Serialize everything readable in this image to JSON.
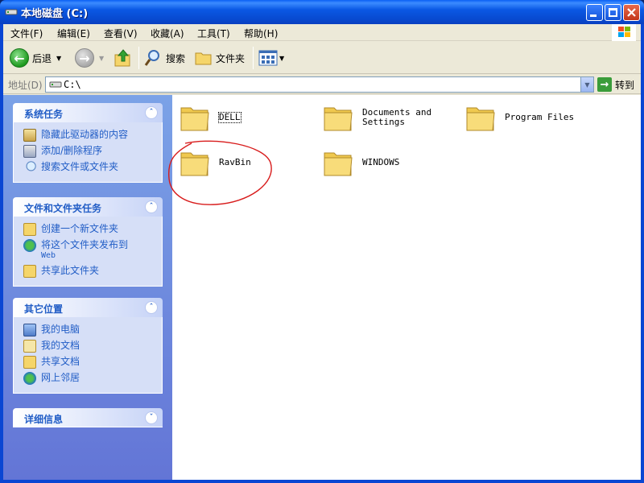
{
  "window": {
    "title": "本地磁盘  (C:)"
  },
  "menu": [
    "文件(F)",
    "编辑(E)",
    "查看(V)",
    "收藏(A)",
    "工具(T)",
    "帮助(H)"
  ],
  "toolbar": {
    "back": "后退",
    "search": "搜索",
    "folders": "文件夹"
  },
  "address": {
    "label": "地址(D)",
    "path": "C:\\",
    "go": "转到"
  },
  "panels": [
    {
      "title": "系统任务",
      "collapse": "up",
      "tasks": [
        {
          "label": "隐藏此驱动器的内容",
          "icon": "hide-drive-icon"
        },
        {
          "label": "添加/删除程序",
          "icon": "add-remove-programs-icon"
        },
        {
          "label": "搜索文件或文件夹",
          "icon": "search-icon"
        }
      ]
    },
    {
      "title": "文件和文件夹任务",
      "collapse": "up",
      "tasks": [
        {
          "label": "创建一个新文件夹",
          "icon": "new-folder-icon"
        },
        {
          "label": "将这个文件夹发布到",
          "sub": "Web",
          "icon": "publish-web-icon"
        },
        {
          "label": "共享此文件夹",
          "icon": "share-folder-icon"
        }
      ]
    },
    {
      "title": "其它位置",
      "collapse": "up",
      "tasks": [
        {
          "label": "我的电脑",
          "icon": "my-computer-icon"
        },
        {
          "label": "我的文档",
          "icon": "my-documents-icon"
        },
        {
          "label": "共享文档",
          "icon": "shared-documents-icon"
        },
        {
          "label": "网上邻居",
          "icon": "network-places-icon"
        }
      ]
    },
    {
      "title": "详细信息",
      "collapse": "down",
      "tasks": []
    }
  ],
  "folders": [
    "DELL",
    "Documents and Settings",
    "Program Files",
    "RavBin",
    "WINDOWS"
  ],
  "colors": {
    "annotation": "#d81c1c",
    "titlebar": "#0a5ff5",
    "link": "#215dc6"
  }
}
